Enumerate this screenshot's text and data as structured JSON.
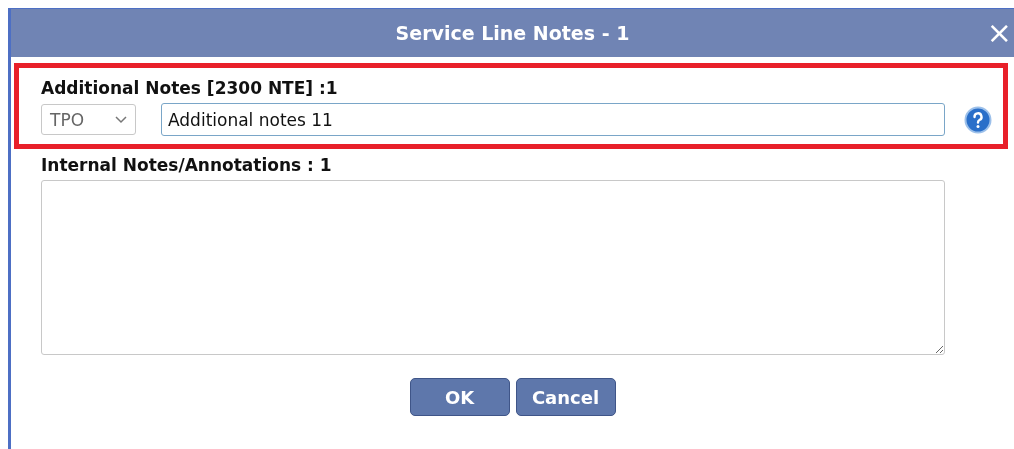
{
  "window": {
    "title": "Service Line Notes - 1",
    "close": "×"
  },
  "additional_notes": {
    "label": "Additional Notes [2300 NTE] :1",
    "qualifier": "TPO",
    "value": "Additional notes 11",
    "highlighted": true
  },
  "internal_notes": {
    "label": "Internal Notes/Annotations : 1"
  },
  "buttons": [
    {
      "label": "OK"
    },
    {
      "label": "Cancel"
    }
  ]
}
